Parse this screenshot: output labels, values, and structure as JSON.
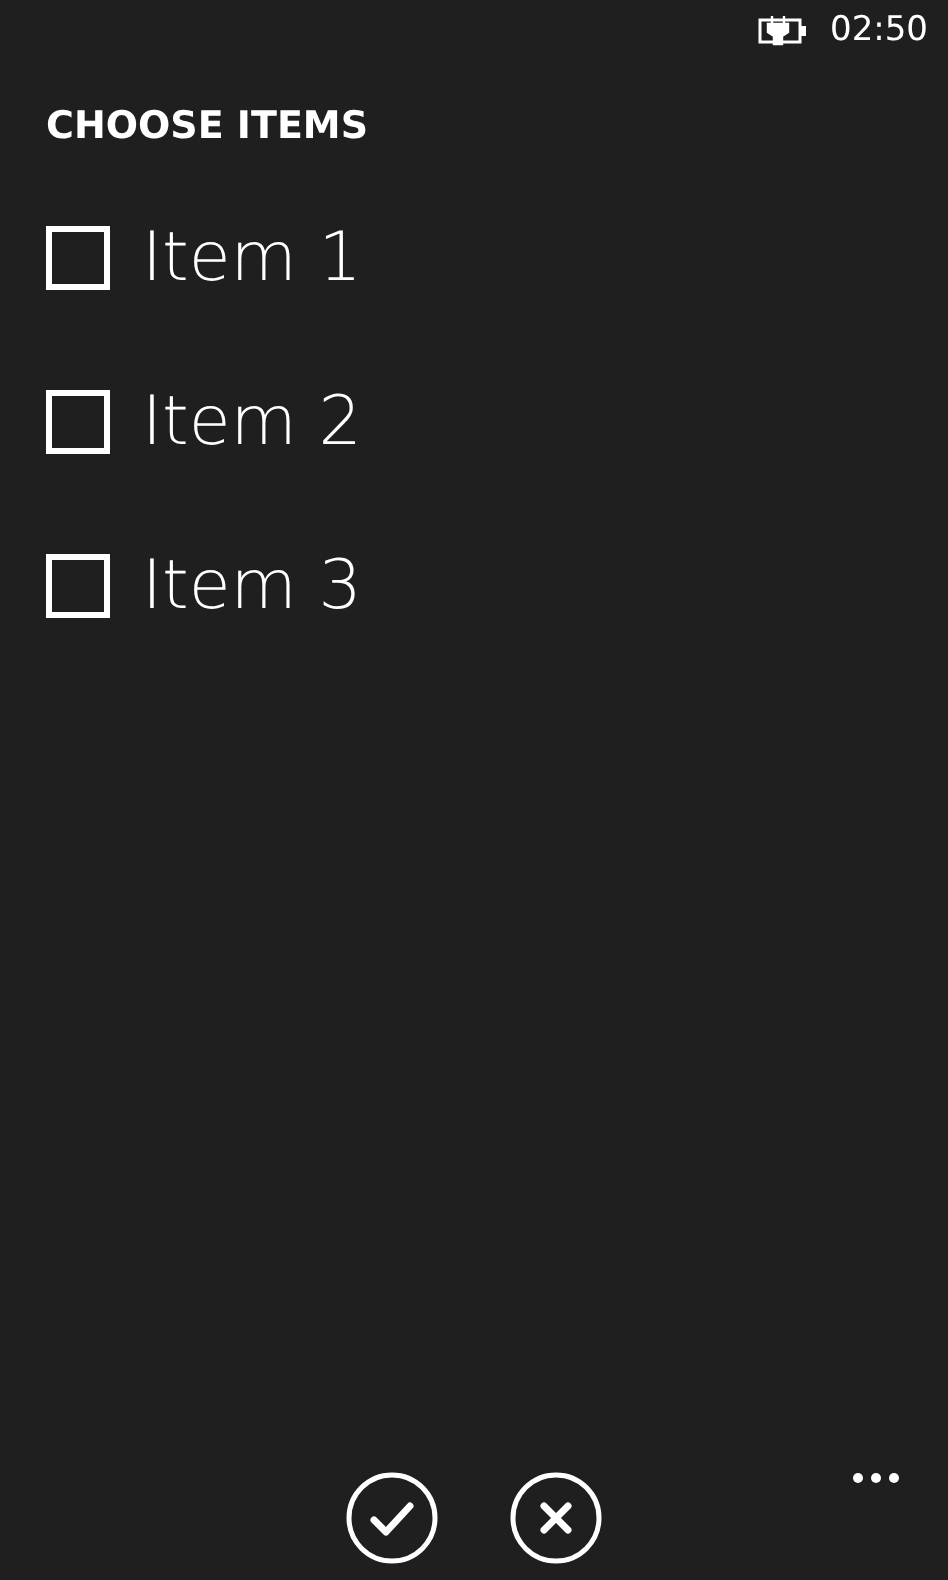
{
  "status_bar": {
    "time": "02:50"
  },
  "title": "CHOOSE ITEMS",
  "items": [
    {
      "label": "Item 1",
      "checked": false
    },
    {
      "label": "Item 2",
      "checked": false
    },
    {
      "label": "Item 3",
      "checked": false
    }
  ],
  "app_bar": {
    "buttons": [
      {
        "kind": "accept"
      },
      {
        "kind": "cancel"
      }
    ]
  }
}
